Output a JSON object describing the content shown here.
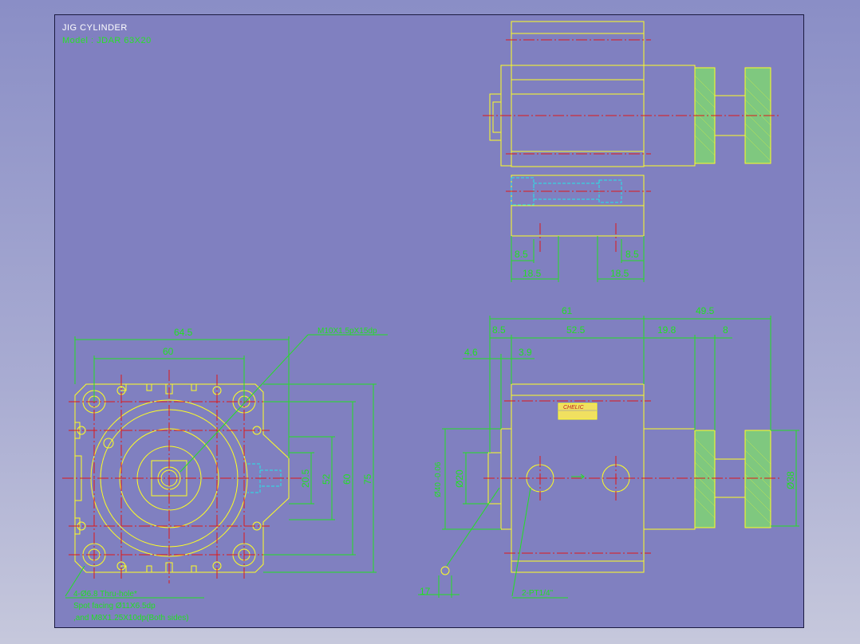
{
  "title": "JIG  CYLINDER",
  "model": "Model : JDAR  63X20",
  "dims": {
    "d645": "64.5",
    "d60h": "60",
    "d205": "20.5",
    "d52": "52",
    "d60v": "60",
    "d75": "75",
    "d85a": "8.5",
    "d185a": "18.5",
    "d85b": "8.5",
    "d185b": "18.5",
    "d61": "61",
    "d495": "49.5",
    "d85c": "8.5",
    "d525": "52.5",
    "d198": "19.8",
    "d8": "8",
    "d46": "4.6",
    "d39": "3.9",
    "d17": "17",
    "d38": "Ø38",
    "d20": "Ø20",
    "d40": "Ø40 -0.06"
  },
  "notes": {
    "thread": "M10X1.5pX15dp",
    "holes1": "4-Ø6.8  Thru-hole*",
    "holes2": "Spot facing  Ø11X6.5dp",
    "holes3": ",and M8X1.25X10dp(Both  sides)",
    "ports": "2-PT1/4\""
  },
  "brand": "CHELIC"
}
